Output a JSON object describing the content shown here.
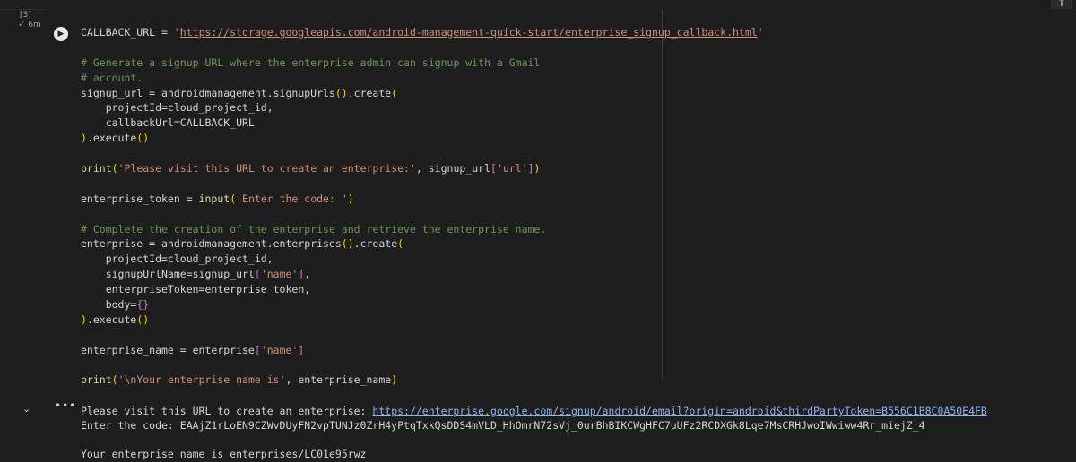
{
  "cell": {
    "execution_count": "[3]",
    "status": "6m",
    "code_lines": [
      [
        {
          "t": "CALLBACK_URL = "
        },
        {
          "t": "'",
          "c": "str"
        },
        {
          "t": "https://storage.googleapis.com/android-management-quick-start/enterprise_signup_callback.html",
          "c": "url"
        },
        {
          "t": "'",
          "c": "str"
        }
      ],
      [],
      [
        {
          "t": "# Generate a signup URL where the enterprise admin can signup with a Gmail",
          "c": "cmt"
        }
      ],
      [
        {
          "t": "# account.",
          "c": "cmt"
        }
      ],
      [
        {
          "t": "signup_url = androidmanagement.signupUrls"
        },
        {
          "t": "()",
          "c": "br"
        },
        {
          "t": ".create"
        },
        {
          "t": "(",
          "c": "br"
        }
      ],
      [
        {
          "t": "    projectId=cloud_project_id,"
        }
      ],
      [
        {
          "t": "    callbackUrl=CALLBACK_URL"
        }
      ],
      [
        {
          "t": ")",
          "c": "br"
        },
        {
          "t": ".execute"
        },
        {
          "t": "()",
          "c": "br"
        }
      ],
      [],
      [
        {
          "t": "print",
          "c": "fn"
        },
        {
          "t": "(",
          "c": "br"
        },
        {
          "t": "'Please visit this URL to create an enterprise:'",
          "c": "str"
        },
        {
          "t": ", signup_url"
        },
        {
          "t": "[",
          "c": "br2"
        },
        {
          "t": "'url'",
          "c": "str"
        },
        {
          "t": "]",
          "c": "br2"
        },
        {
          "t": ")",
          "c": "br"
        }
      ],
      [],
      [
        {
          "t": "enterprise_token = "
        },
        {
          "t": "input",
          "c": "fn"
        },
        {
          "t": "(",
          "c": "br"
        },
        {
          "t": "'Enter the code: '",
          "c": "str"
        },
        {
          "t": ")",
          "c": "br"
        }
      ],
      [],
      [
        {
          "t": "# Complete the creation of the enterprise and retrieve the enterprise name.",
          "c": "cmt"
        }
      ],
      [
        {
          "t": "enterprise = androidmanagement.enterprises"
        },
        {
          "t": "()",
          "c": "br"
        },
        {
          "t": ".create"
        },
        {
          "t": "(",
          "c": "br"
        }
      ],
      [
        {
          "t": "    projectId=cloud_project_id,"
        }
      ],
      [
        {
          "t": "    signupUrlName=signup_url"
        },
        {
          "t": "[",
          "c": "br2"
        },
        {
          "t": "'name'",
          "c": "str"
        },
        {
          "t": "]",
          "c": "br2"
        },
        {
          "t": ","
        }
      ],
      [
        {
          "t": "    enterpriseToken=enterprise_token,"
        }
      ],
      [
        {
          "t": "    body="
        },
        {
          "t": "{}",
          "c": "br2"
        }
      ],
      [
        {
          "t": ")",
          "c": "br"
        },
        {
          "t": ".execute"
        },
        {
          "t": "()",
          "c": "br"
        }
      ],
      [],
      [
        {
          "t": "enterprise_name = enterprise"
        },
        {
          "t": "[",
          "c": "br2"
        },
        {
          "t": "'name'",
          "c": "str"
        },
        {
          "t": "]",
          "c": "br2"
        }
      ],
      [],
      [
        {
          "t": "print",
          "c": "fn"
        },
        {
          "t": "(",
          "c": "br"
        },
        {
          "t": "'\\nYour enterprise name is'",
          "c": "str"
        },
        {
          "t": ", enterprise_name"
        },
        {
          "t": ")",
          "c": "br"
        }
      ]
    ]
  },
  "output": {
    "line1_prefix": "Please visit this URL to create an enterprise: ",
    "line1_link": "https://enterprise.google.com/signup/android/email?origin=android&thirdPartyToken=B556C1B8C0A50E4FB",
    "line2": "Enter the code: EAAjZ1rLoEN9CZWvDUyFN2vpTUNJz0ZrH4yPtqTxkQsDDS4mVLD_HhOmrN72sVj_0urBhBIKCWgHFC7uUFz2RCDXGk8Lqe7MsCRHJwoIWwiww4Rr_miejZ_4",
    "line3": "",
    "line4": "Your enterprise name is enterprises/LC01e95rwz"
  },
  "icons": {
    "run": "▶",
    "check": "✓",
    "collapse": "⌄",
    "more": "•••",
    "scroll_up": "↑"
  },
  "colors": {
    "background": "#1e1e1e",
    "string": "#ce9178",
    "comment": "#6a9955",
    "function": "#dcdcaa",
    "bracket": "#ffd700",
    "bracket2": "#da70d6",
    "link": "#8ab4f8",
    "success": "#5bb974"
  }
}
